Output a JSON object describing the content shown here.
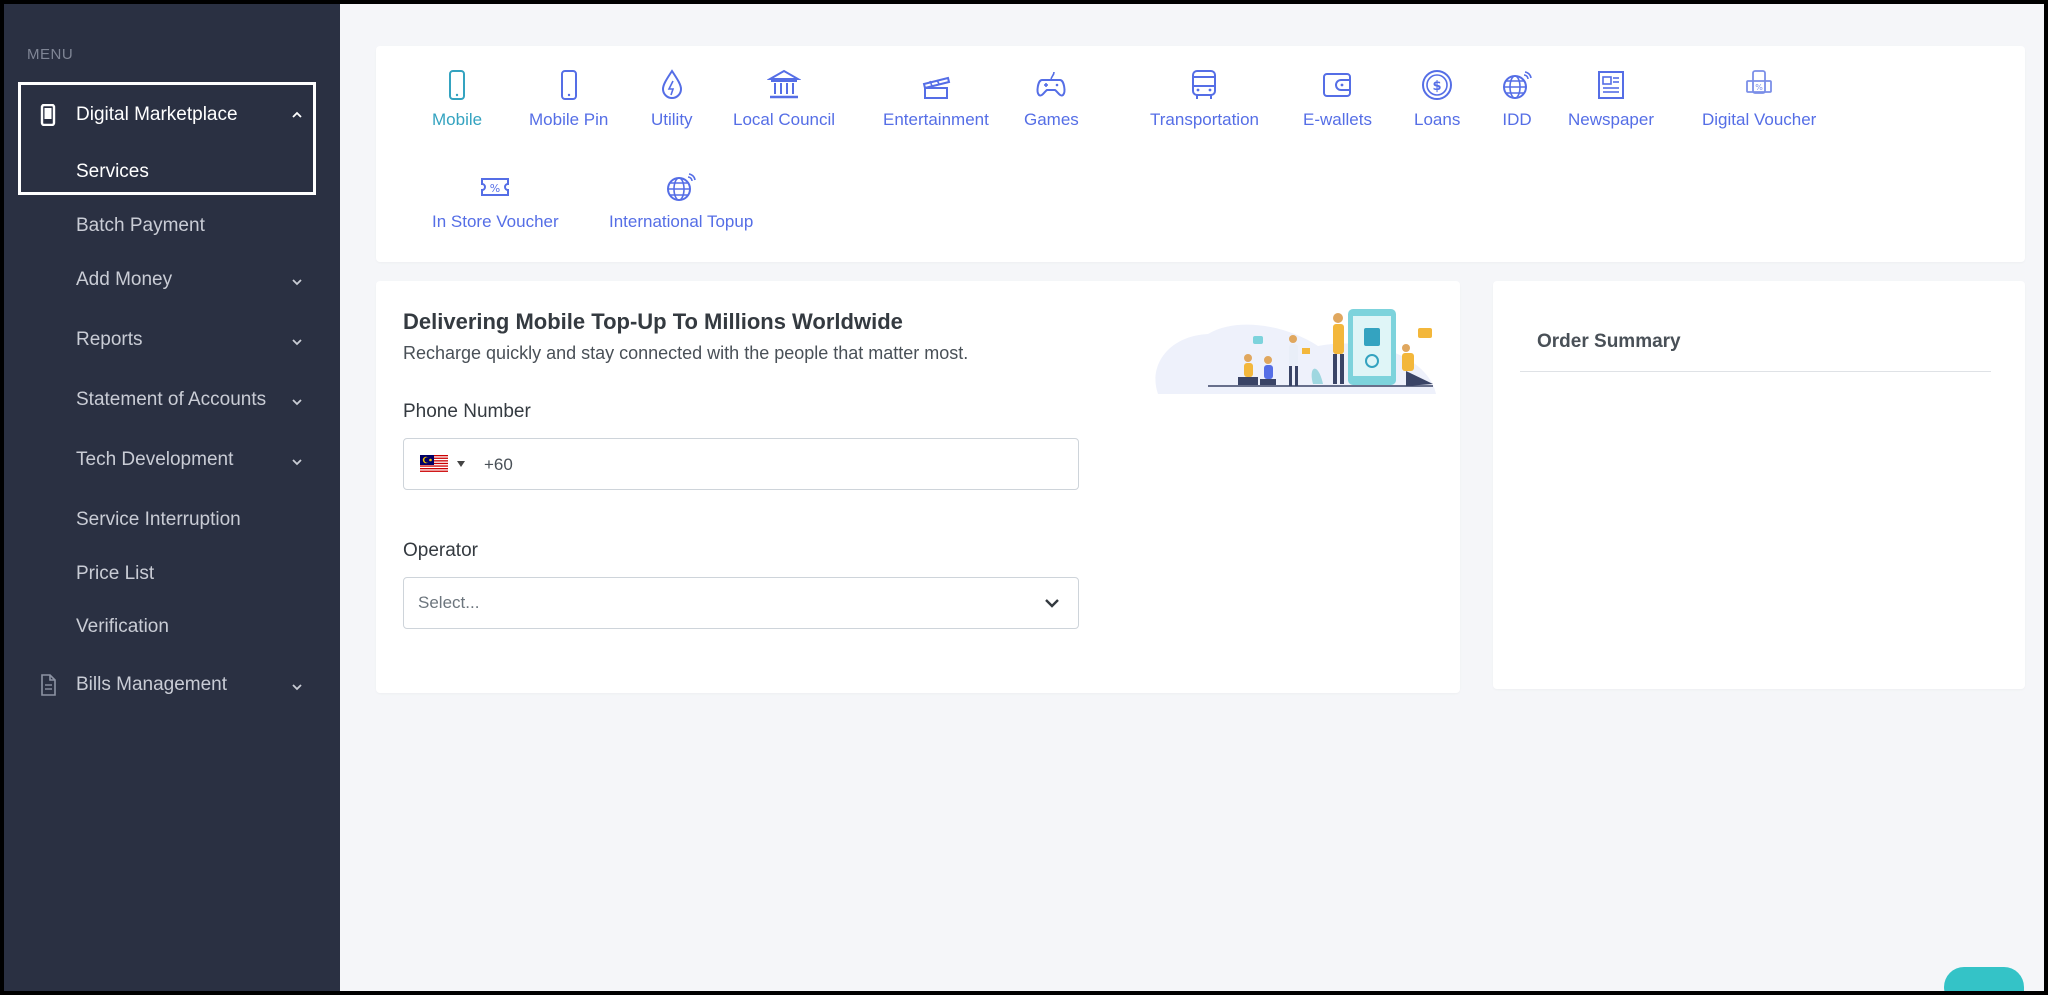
{
  "sidebar": {
    "menu_title": "MENU",
    "items": [
      {
        "label": "Digital Marketplace",
        "icon": "mobile-icon",
        "expanded": true
      },
      {
        "label": "Services",
        "active": true
      },
      {
        "label": "Batch Payment"
      },
      {
        "label": "Add Money"
      },
      {
        "label": "Reports"
      },
      {
        "label": "Statement of Accounts"
      },
      {
        "label": "Tech Development"
      },
      {
        "label": "Service Interruption"
      },
      {
        "label": "Price List"
      },
      {
        "label": "Verification"
      },
      {
        "label": "Bills Management",
        "icon": "document-icon"
      }
    ]
  },
  "services": [
    {
      "label": "Mobile",
      "icon": "mobile-icon",
      "active": true
    },
    {
      "label": "Mobile Pin",
      "icon": "mobile-pin-icon"
    },
    {
      "label": "Utility",
      "icon": "utility-drop-icon"
    },
    {
      "label": "Local Council",
      "icon": "bank-building-icon"
    },
    {
      "label": "Entertainment",
      "icon": "entertainment-icon"
    },
    {
      "label": "Games",
      "icon": "gamepad-icon"
    },
    {
      "label": "Transportation",
      "icon": "bus-icon"
    },
    {
      "label": "E-wallets",
      "icon": "wallet-icon"
    },
    {
      "label": "Loans",
      "icon": "dollar-coin-icon"
    },
    {
      "label": "IDD",
      "icon": "globe-signal-icon"
    },
    {
      "label": "Newspaper",
      "icon": "newspaper-icon"
    },
    {
      "label": "Digital Voucher",
      "icon": "digital-voucher-icon"
    },
    {
      "label": "In Store Voucher",
      "icon": "percent-voucher-icon"
    },
    {
      "label": "International Topup",
      "icon": "globe-signal-icon"
    }
  ],
  "topup": {
    "title": "Delivering Mobile Top-Up To Millions Worldwide",
    "subtitle": "Recharge quickly and stay connected with the people that matter most.",
    "phone_label": "Phone Number",
    "phone_value": "+60",
    "country_flag": "malaysia-flag-icon",
    "operator_label": "Operator",
    "operator_placeholder": "Select..."
  },
  "summary": {
    "title": "Order Summary"
  },
  "colors": {
    "sidebar_bg": "#2a3042",
    "accent": "#556ee6",
    "active_service": "#34a3c0",
    "page_bg": "#f5f6f9"
  }
}
